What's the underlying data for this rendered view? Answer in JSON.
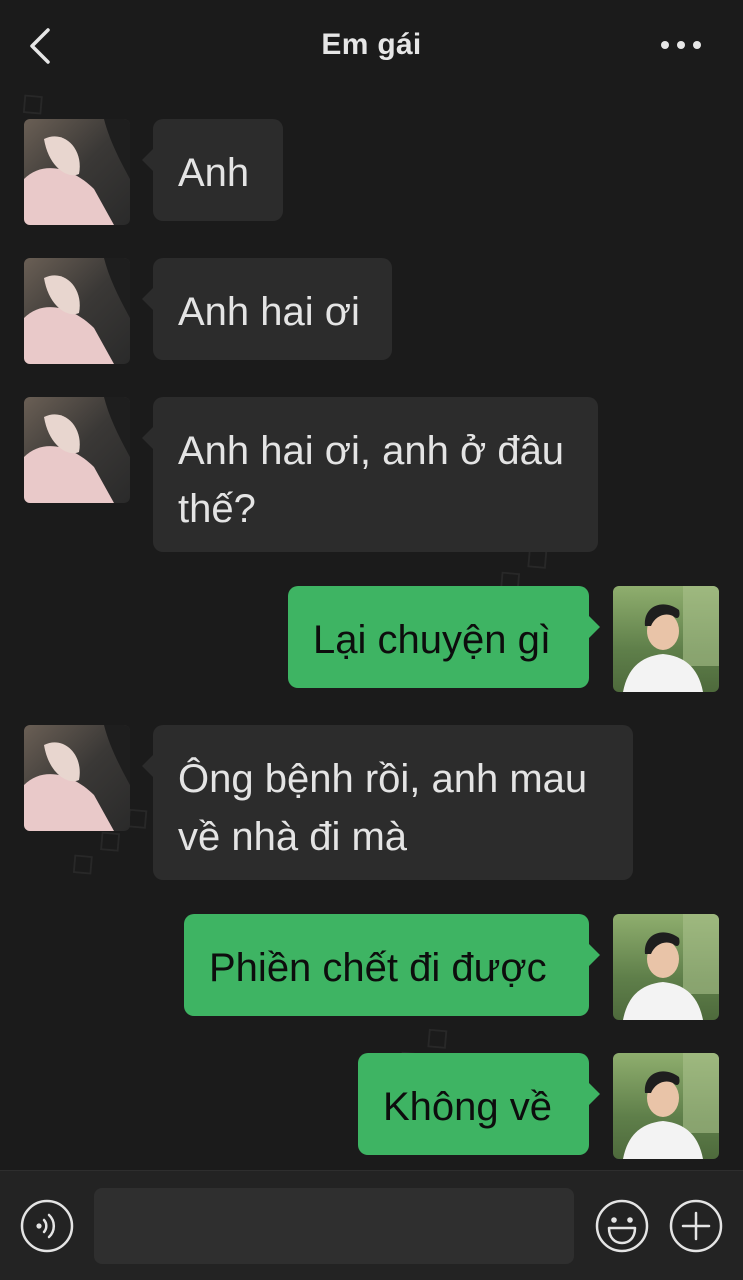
{
  "header": {
    "title": "Em gái",
    "back_icon": "chevron-left-icon",
    "more_icon": "more-dots-icon"
  },
  "messages": [
    {
      "direction": "in",
      "lines": [
        "Anh"
      ]
    },
    {
      "direction": "in",
      "lines": [
        "Anh hai ơi"
      ]
    },
    {
      "direction": "in",
      "lines": [
        "Anh hai ơi, anh ở đâu",
        "thế?"
      ]
    },
    {
      "direction": "out",
      "lines": [
        "Lại chuyện gì"
      ]
    },
    {
      "direction": "in",
      "lines": [
        "Ông bệnh rồi, anh mau",
        "về nhà đi mà"
      ]
    },
    {
      "direction": "out",
      "lines": [
        "Phiền chết đi được"
      ]
    },
    {
      "direction": "out",
      "lines": [
        "Không về"
      ]
    }
  ],
  "input_bar": {
    "voice_icon": "voice-icon",
    "emoji_icon": "emoji-icon",
    "plus_icon": "plus-icon",
    "text_value": ""
  },
  "colors": {
    "background": "#1b1b1b",
    "incoming_bubble": "#2c2c2c",
    "outgoing_bubble": "#3eb463",
    "incoming_text": "#e4e4e4",
    "outgoing_text": "#0d0d0d"
  }
}
